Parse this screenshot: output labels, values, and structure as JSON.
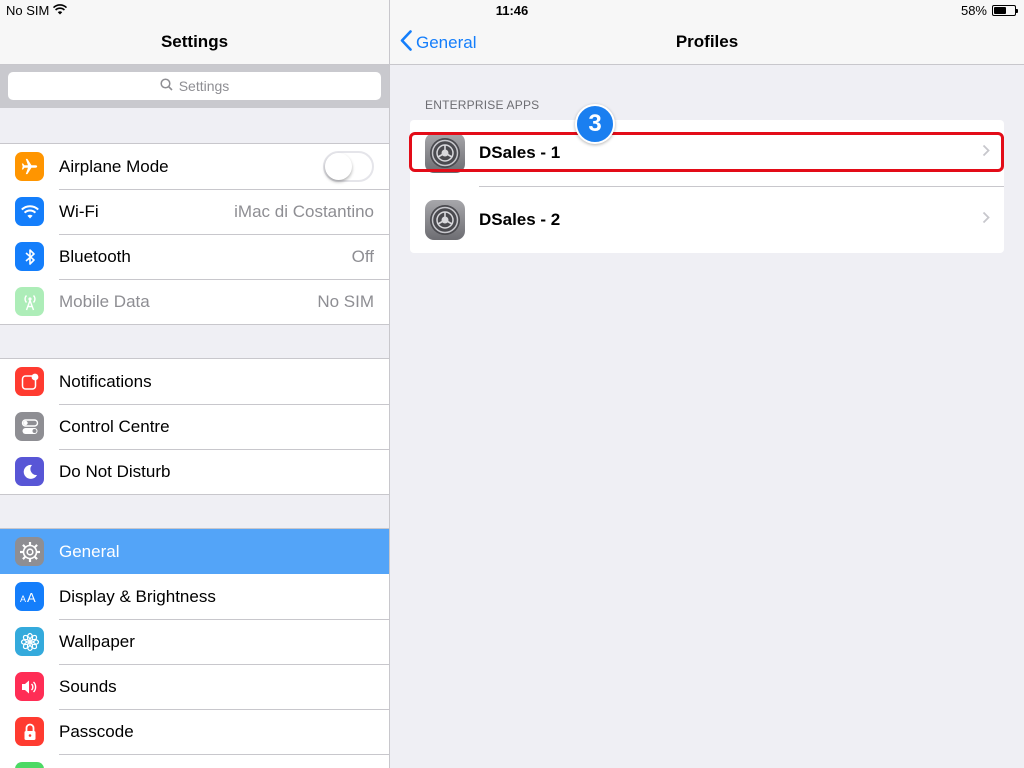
{
  "status_bar": {
    "carrier": "No SIM",
    "time": "11:46",
    "battery_text": "58%",
    "battery_level": 0.58
  },
  "master": {
    "title": "Settings",
    "search_placeholder": "Settings",
    "groups": [
      [
        {
          "label": "Airplane Mode",
          "icon": "airplane-icon",
          "color": "#ff9500",
          "control": "toggle-off"
        },
        {
          "label": "Wi-Fi",
          "icon": "wifi-icon",
          "color": "#147efb",
          "value": "iMac di Costantino"
        },
        {
          "label": "Bluetooth",
          "icon": "bluetooth-icon",
          "color": "#147efb",
          "value": "Off"
        },
        {
          "label": "Mobile Data",
          "icon": "antenna-icon",
          "color": "#4cd964",
          "value": "No SIM",
          "disabled": true
        }
      ],
      [
        {
          "label": "Notifications",
          "icon": "notifications-icon",
          "color": "#ff3b30"
        },
        {
          "label": "Control Centre",
          "icon": "control-centre-icon",
          "color": "#8e8e93"
        },
        {
          "label": "Do Not Disturb",
          "icon": "moon-icon",
          "color": "#5856d6"
        }
      ],
      [
        {
          "label": "General",
          "icon": "gear-icon",
          "color": "#8e8e93",
          "selected": true
        },
        {
          "label": "Display & Brightness",
          "icon": "display-brightness-icon",
          "color": "#147efb"
        },
        {
          "label": "Wallpaper",
          "icon": "wallpaper-icon",
          "color": "#34aadc"
        },
        {
          "label": "Sounds",
          "icon": "speaker-icon",
          "color": "#ff2d55"
        },
        {
          "label": "Passcode",
          "icon": "lock-icon",
          "color": "#ff3b30"
        }
      ]
    ]
  },
  "detail": {
    "back_label": "General",
    "title": "Profiles",
    "section_header": "ENTERPRISE APPS",
    "profiles": [
      {
        "label": "DSales - 1",
        "icon": "settings-gear-icon"
      },
      {
        "label": "DSales - 2",
        "icon": "settings-gear-icon"
      }
    ]
  },
  "annotation": {
    "step_number": "3",
    "highlight_color": "#e30c18",
    "badge_color": "#1a7ff0"
  }
}
